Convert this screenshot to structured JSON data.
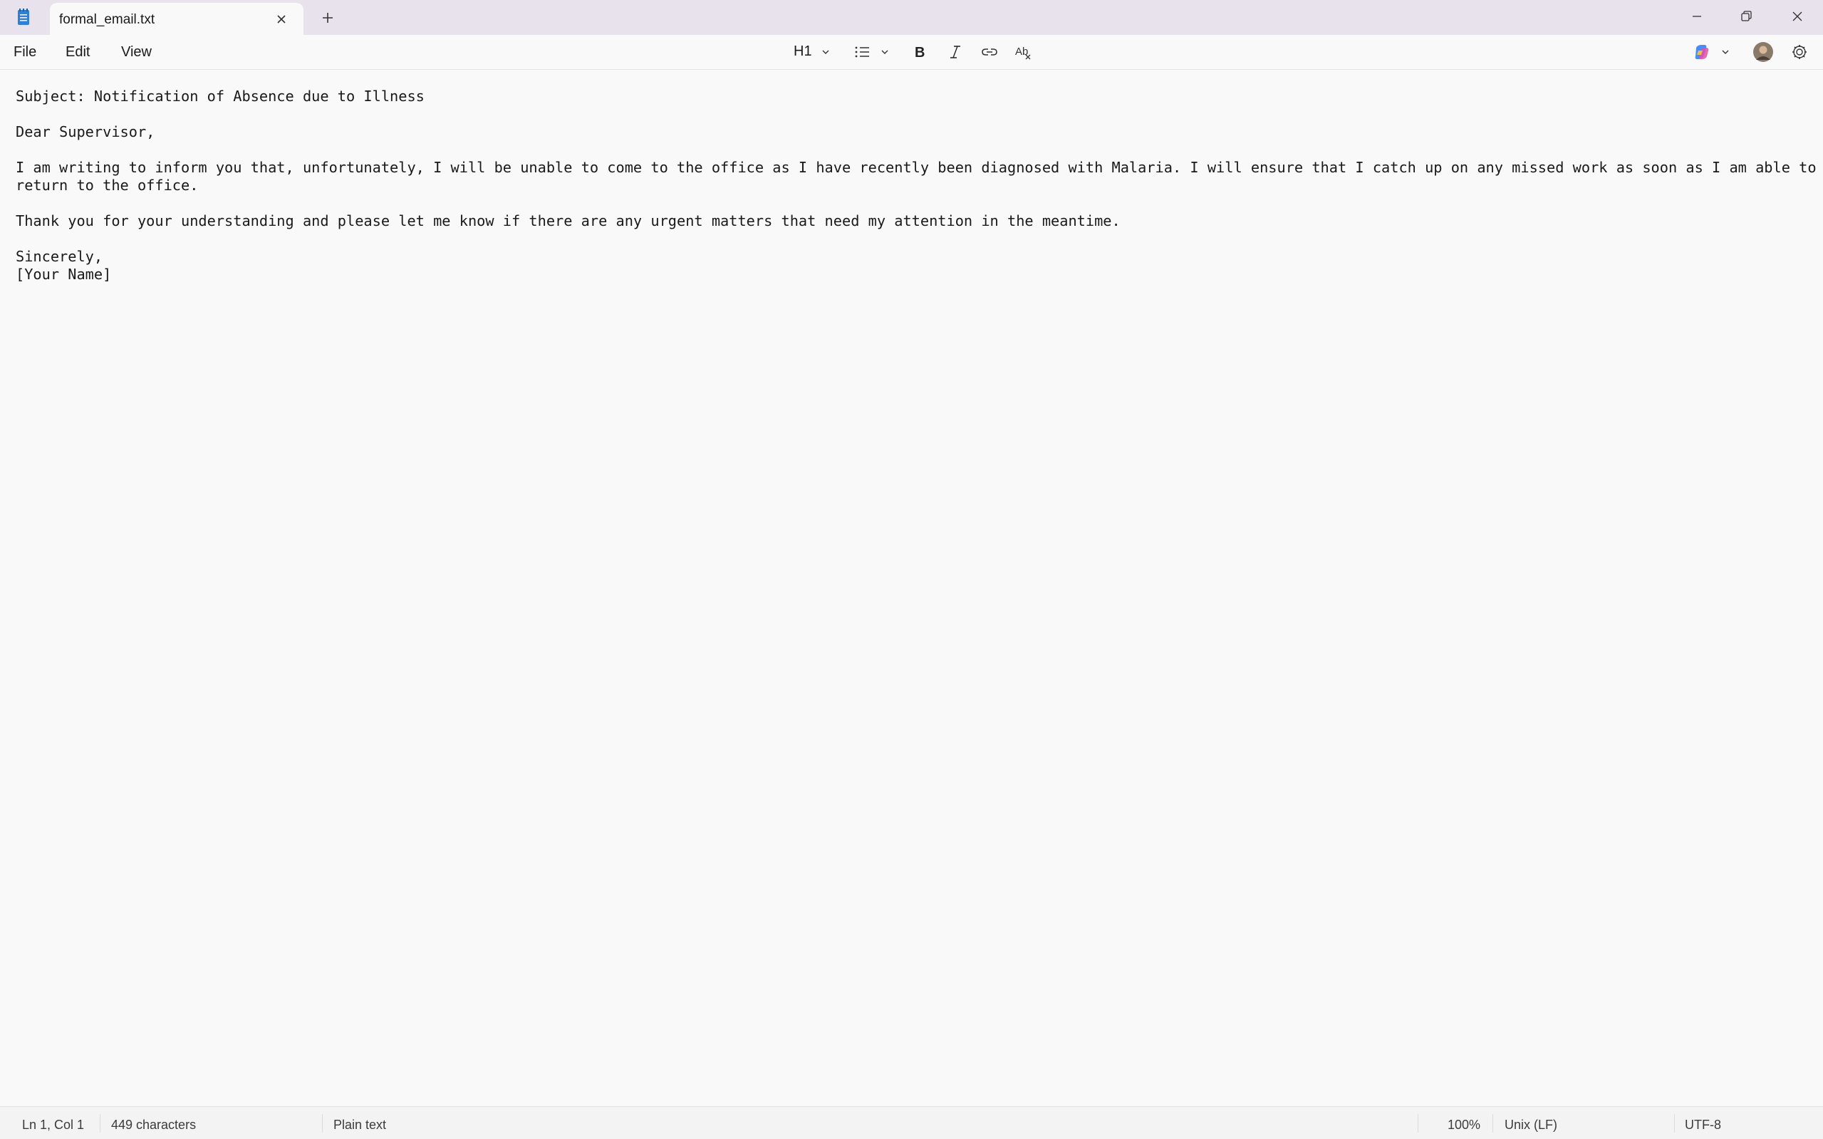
{
  "tab": {
    "title": "formal_email.txt"
  },
  "menu": {
    "file": "File",
    "edit": "Edit",
    "view": "View"
  },
  "toolbar": {
    "heading": "H1"
  },
  "editor": {
    "lines": [
      "Subject: Notification of Absence due to Illness",
      "",
      "Dear Supervisor,",
      "",
      "I am writing to inform you that, unfortunately, I will be unable to come to the office as I have recently been diagnosed with Malaria. I will ensure that I catch up on any missed work as soon as I am able to",
      "return to the office.",
      "",
      "Thank you for your understanding and please let me know if there are any urgent matters that need my attention in the meantime.",
      "",
      "Sincerely,",
      "[Your Name]"
    ]
  },
  "status": {
    "position": "Ln 1, Col 1",
    "characters": "449 characters",
    "format": "Plain text",
    "zoom": "100%",
    "line_ending": "Unix (LF)",
    "encoding": "UTF-8"
  },
  "colors": {
    "titlebar": "#e7e2ec",
    "editor_bg": "#f9f9f9",
    "copilot_accent": "#7b5cf0"
  },
  "icons": {
    "app": "notepad-icon",
    "close": "close-icon",
    "add": "plus-icon",
    "minimize": "minimize-icon",
    "restore": "restore-icon",
    "list": "bulleted-list-icon",
    "bold": "bold-icon",
    "italic": "italic-icon",
    "link": "link-icon",
    "clear_format": "clear-formatting-icon",
    "copilot": "copilot-icon",
    "avatar": "avatar",
    "settings": "gear-icon"
  }
}
